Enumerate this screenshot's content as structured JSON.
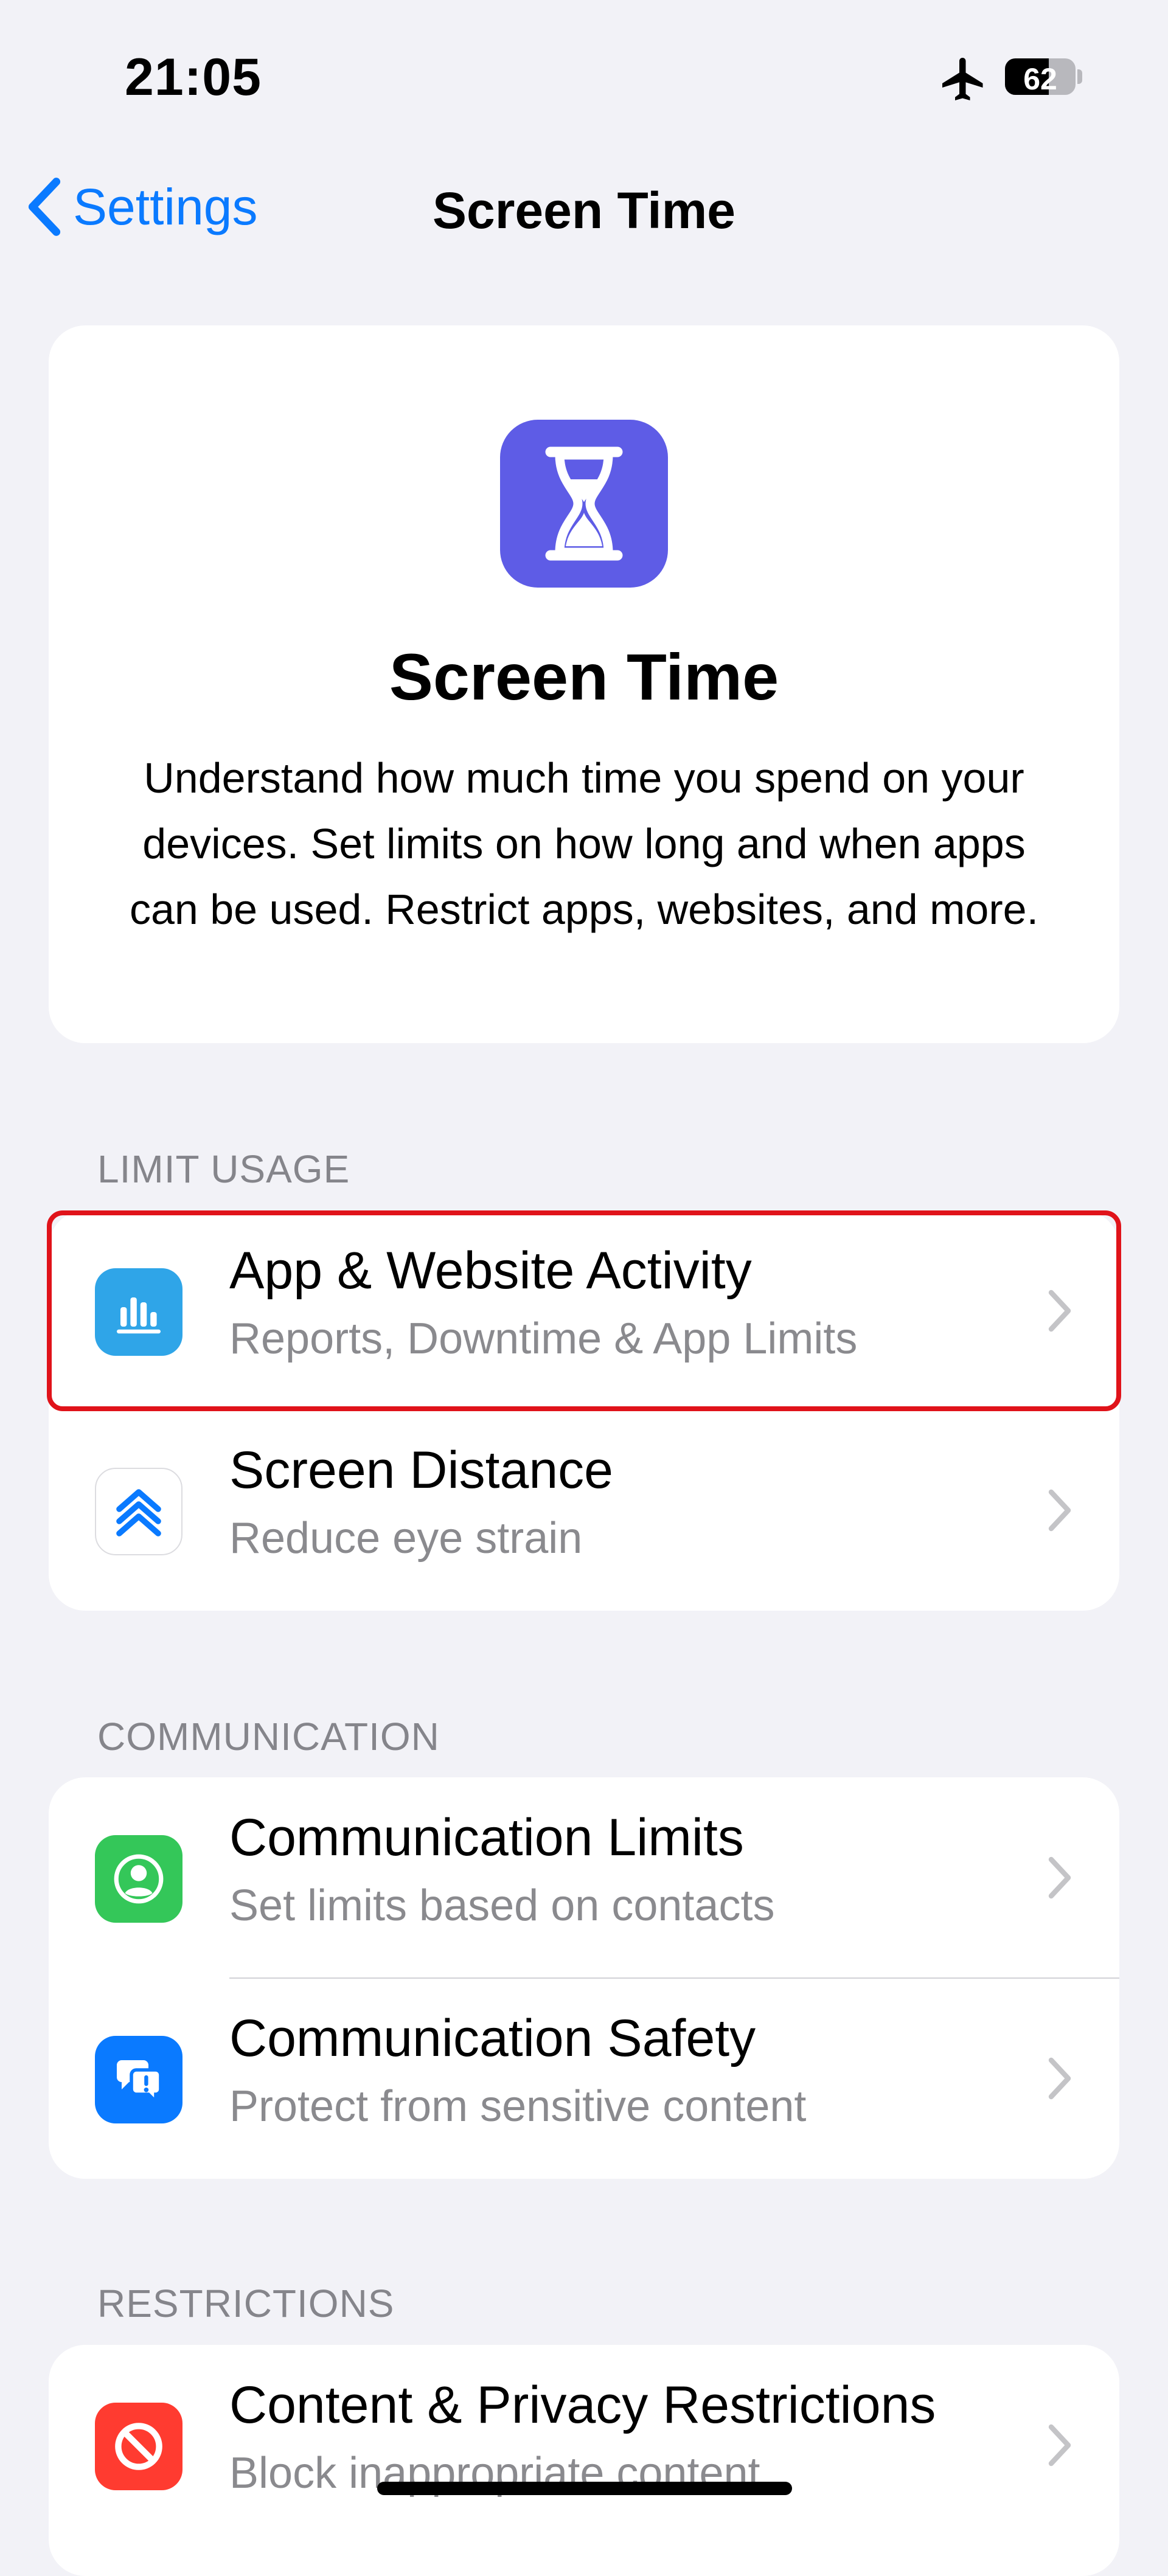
{
  "status_bar": {
    "time": "21:05",
    "battery_level": "62",
    "battery_fraction": 0.62,
    "icons": [
      "airplane-icon",
      "battery-icon"
    ]
  },
  "nav": {
    "back_label": "Settings",
    "title": "Screen Time"
  },
  "hero": {
    "icon": "hourglass-icon",
    "icon_color": "#5e5ce6",
    "title": "Screen Time",
    "description": "Understand how much time you spend on your devices. Set limits on how long and when apps can be used. Restrict apps, websites, and more."
  },
  "sections": {
    "limit_usage": {
      "header": "LIMIT USAGE",
      "rows": [
        {
          "title": "App & Website Activity",
          "subtitle": "Reports, Downtime & App Limits",
          "icon": "bar-chart-icon",
          "highlighted": true
        },
        {
          "title": "Screen Distance",
          "subtitle": "Reduce eye strain",
          "icon": "chevrons-up-icon"
        }
      ]
    },
    "communication": {
      "header": "COMMUNICATION",
      "rows": [
        {
          "title": "Communication Limits",
          "subtitle": "Set limits based on contacts",
          "icon": "person-circle-icon"
        },
        {
          "title": "Communication Safety",
          "subtitle": "Protect from sensitive content",
          "icon": "chat-bubbles-icon"
        }
      ]
    },
    "restrictions": {
      "header": "RESTRICTIONS",
      "rows": [
        {
          "title": "Content & Privacy Restrictions",
          "subtitle": "Block inappropriate content",
          "icon": "no-entry-icon"
        }
      ]
    }
  },
  "colors": {
    "accent": "#0a7aff",
    "highlight": "#e0131a",
    "activity_icon_bg": "#2fa5e8",
    "communication_limits_bg": "#34c759",
    "communication_safety_bg": "#0a7aff",
    "restrictions_bg": "#ff3b30"
  }
}
